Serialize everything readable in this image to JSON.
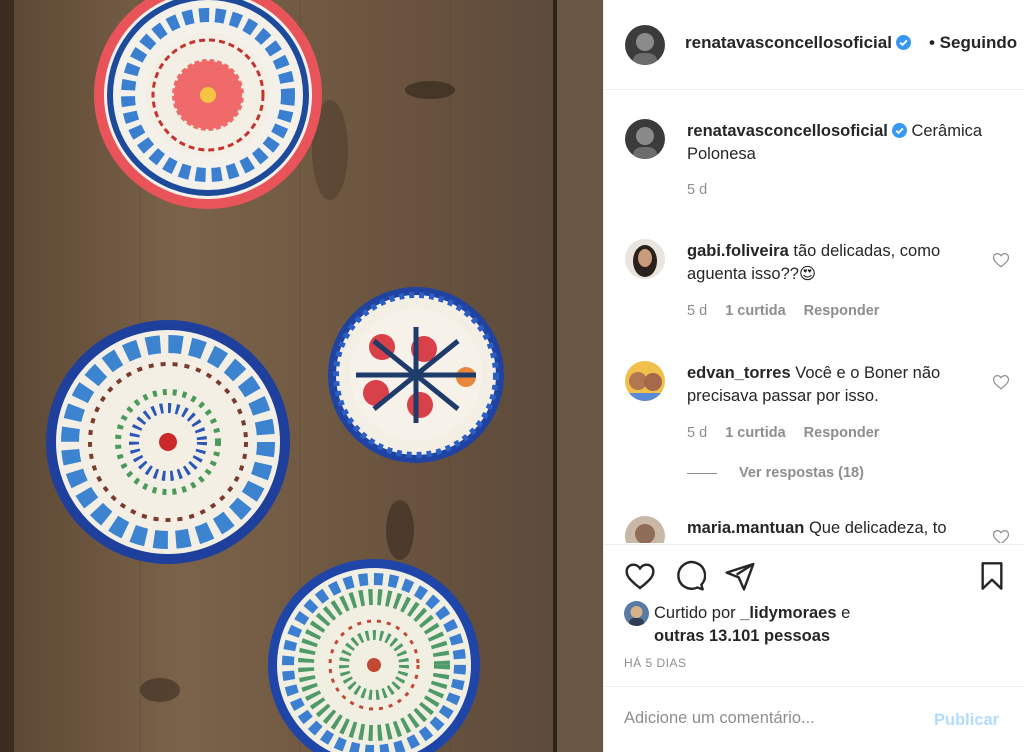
{
  "post": {
    "author": "renatavasconcellosoficial",
    "follow_label": "• Seguindo"
  },
  "caption": {
    "author": "renatavasconcellosoficial",
    "text": "Cerâmica Polonesa",
    "time": "5 d"
  },
  "comments": [
    {
      "author": "gabi.foliveira",
      "text": "tão delicadas, como aguenta isso??😍",
      "time": "5 d",
      "likes": "1 curtida",
      "reply": "Responder"
    },
    {
      "author": "edvan_torres",
      "text": "Você e o Boner não precisava passar por isso.",
      "time": "5 d",
      "likes": "1 curtida",
      "reply": "Responder",
      "view_replies": "Ver respostas (18)"
    },
    {
      "author": "maria.mantuan",
      "text": "Que delicadeza, to"
    }
  ],
  "likes": {
    "prefix": "Curtido por ",
    "user": "_lidymoraes",
    "conj": " e",
    "others": "outras 13.101 pessoas"
  },
  "time_ago": "HÁ 5 DIAS",
  "add_comment": {
    "placeholder": "Adicione um comentário...",
    "publish": "Publicar"
  },
  "icons": [
    "heart-icon",
    "comment-icon",
    "share-icon",
    "bookmark-icon",
    "verified-icon"
  ],
  "colors": {
    "verified": "#3897f0",
    "publish_disabled": "#b3dbff",
    "muted": "#8e8e8e"
  }
}
